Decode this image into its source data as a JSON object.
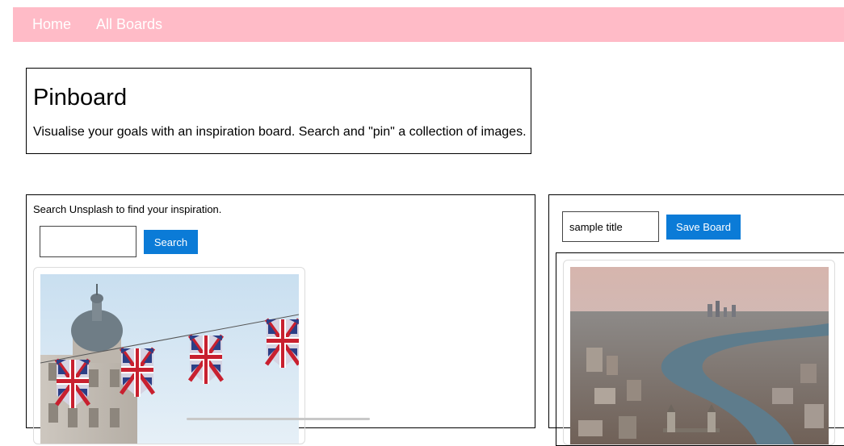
{
  "nav": {
    "home": "Home",
    "all_boards": "All Boards",
    "bg_color": "#ffbbc7"
  },
  "intro": {
    "title": "Pinboard",
    "description": "Visualise your goals with an inspiration board. Search and \"pin\" a collection of images."
  },
  "search": {
    "hint": "Search Unsplash to find your inspiration.",
    "query_value": "",
    "button_label": "Search",
    "results": [
      {
        "image_subject": "Union Jack bunting in front of an ornate London building"
      }
    ]
  },
  "board": {
    "title_value": "sample title",
    "save_label": "Save Board",
    "pins": [
      {
        "image_subject": "Aerial view of London and the River Thames with Tower Bridge"
      }
    ]
  },
  "colors": {
    "accent_button": "#0b7bd7"
  }
}
